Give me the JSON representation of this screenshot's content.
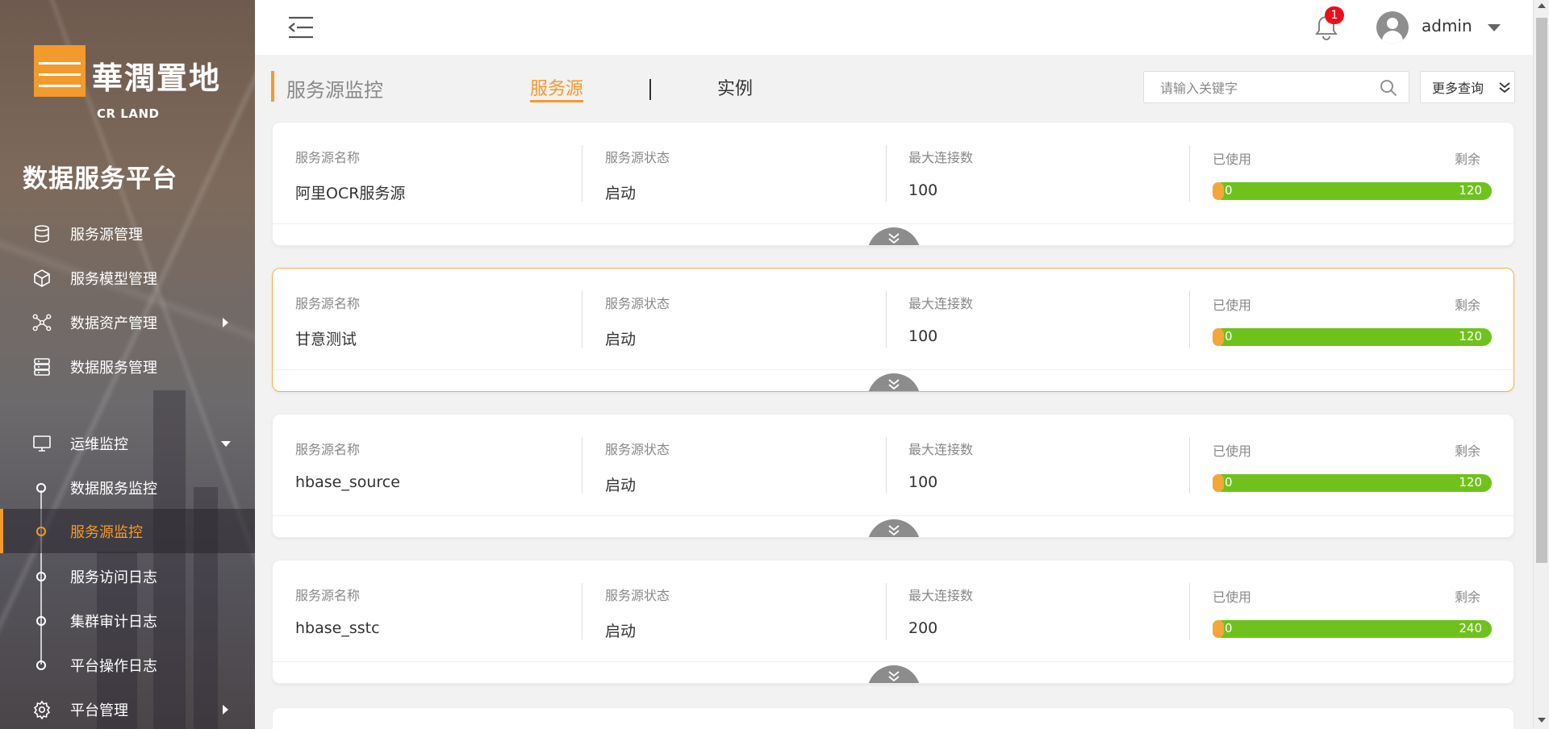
{
  "sidebar": {
    "logo_text": "華潤置地",
    "logo_en": "CR LAND",
    "app_title": "数据服务平台",
    "items": [
      {
        "label": "服务源管理",
        "icon": "database-icon"
      },
      {
        "label": "服务模型管理",
        "icon": "cube-icon"
      },
      {
        "label": "数据资产管理",
        "icon": "network-icon"
      },
      {
        "label": "数据服务管理",
        "icon": "server-icon"
      },
      {
        "label": "运维监控",
        "icon": "monitor-icon"
      },
      {
        "label": "平台管理",
        "icon": "gear-icon"
      }
    ],
    "sub_items": [
      {
        "label": "数据服务监控"
      },
      {
        "label": "服务源监控"
      },
      {
        "label": "服务访问日志"
      },
      {
        "label": "集群审计日志"
      },
      {
        "label": "平台操作日志"
      }
    ]
  },
  "topbar": {
    "notification_count": "1",
    "username": "admin"
  },
  "header": {
    "page_title": "服务源监控",
    "tabs": [
      {
        "label": "服务源"
      },
      {
        "label": "实例"
      }
    ],
    "search_placeholder": "请输入关键字",
    "more_query_label": "更多查询"
  },
  "cards": [
    {
      "name_label": "服务源名称",
      "name": "阿里OCR服务源",
      "status_label": "服务源状态",
      "status": "启动",
      "max_label": "最大连接数",
      "max": "100",
      "used_label": "已使用",
      "remain_label": "剩余",
      "used": "0",
      "remain": "120",
      "used_fraction": 0
    },
    {
      "name_label": "服务源名称",
      "name": "甘意测试",
      "status_label": "服务源状态",
      "status": "启动",
      "max_label": "最大连接数",
      "max": "100",
      "used_label": "已使用",
      "remain_label": "剩余",
      "used": "0",
      "remain": "120",
      "used_fraction": 0
    },
    {
      "name_label": "服务源名称",
      "name": "hbase_source",
      "status_label": "服务源状态",
      "status": "启动",
      "max_label": "最大连接数",
      "max": "100",
      "used_label": "已使用",
      "remain_label": "剩余",
      "used": "0",
      "remain": "120",
      "used_fraction": 0
    },
    {
      "name_label": "服务源名称",
      "name": "hbase_sstc",
      "status_label": "服务源状态",
      "status": "启动",
      "max_label": "最大连接数",
      "max": "200",
      "used_label": "已使用",
      "remain_label": "剩余",
      "used": "0",
      "remain": "240",
      "used_fraction": 0
    }
  ],
  "colors": {
    "accent": "#f39a2c",
    "progress_bar": "#6fc21b",
    "badge": "#e8101a"
  }
}
